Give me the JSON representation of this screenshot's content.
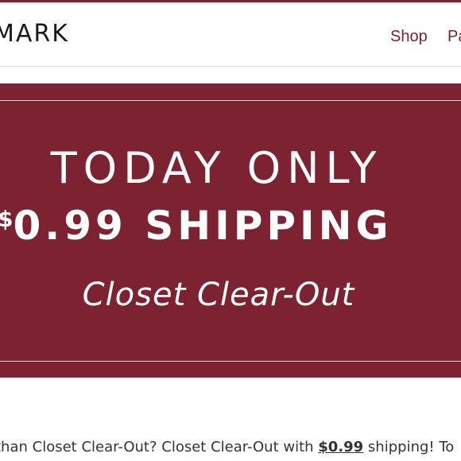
{
  "theme": {
    "accent": "#7d2230",
    "banner_rule": "#e9c9cd",
    "text": "#333333"
  },
  "header": {
    "logo_text": "MARK",
    "nav": {
      "shop": "Shop",
      "party": "Pa"
    }
  },
  "banner": {
    "headline": "TODAY ONLY",
    "currency_symbol": "$",
    "shipping_text": "0.99 SHIPPING",
    "subline": "Closet Clear-Out"
  },
  "caption": {
    "prefix": "than Closet Clear-Out? Closet Clear-Out with ",
    "price": "$0.99",
    "suffix": " shipping! To"
  }
}
